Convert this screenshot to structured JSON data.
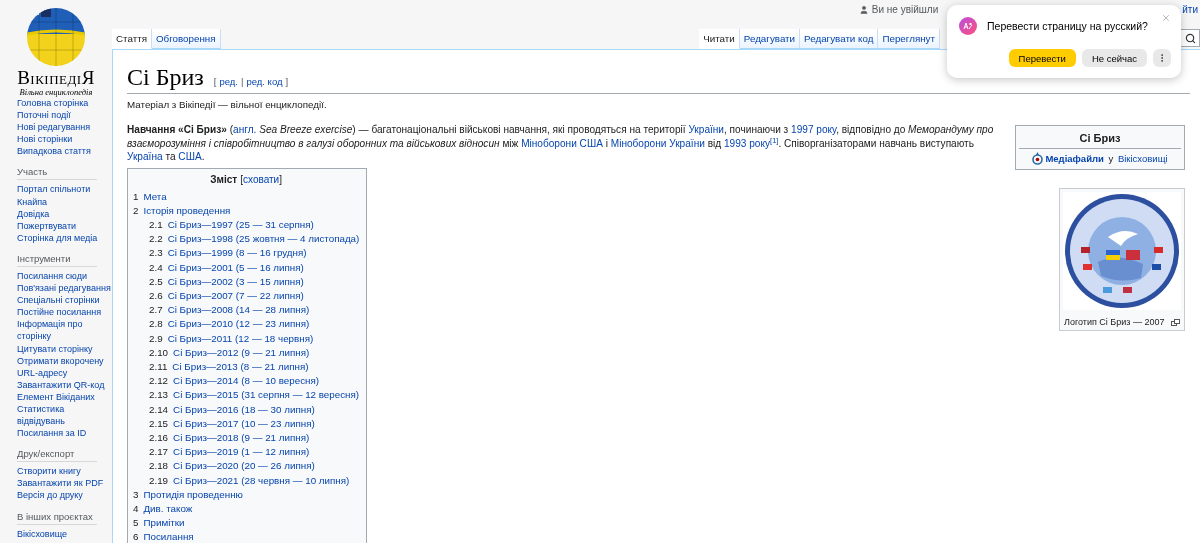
{
  "logo": {
    "wordmark": "ВікіпедіЯ",
    "tagline": "Вільна енциклопедія"
  },
  "sidebar": {
    "sections": [
      {
        "items": [
          "Головна сторінка",
          "Поточні події",
          "Нові редагування",
          "Нові сторінки",
          "Випадкова стаття"
        ]
      },
      {
        "heading": "Участь",
        "items": [
          "Портал спільноти",
          "Кнайпа",
          "Довідка",
          "Пожертвувати",
          "Сторінка для медіа"
        ]
      },
      {
        "heading": "Інструменти",
        "items": [
          "Посилання сюди",
          "Пов'язані редагування",
          "Спеціальні сторінки",
          "Постійне посилання",
          "Інформація про сторінку",
          "Цитувати сторінку",
          "Отримати вкорочену URL-адресу",
          "Завантажити QR-код",
          "Елемент Вікіданих",
          "Статистика відвідувань",
          "Посилання за ID"
        ]
      },
      {
        "heading": "Друк/експорт",
        "items": [
          "Створити книгу",
          "Завантажити як PDF",
          "Версія до друку"
        ]
      },
      {
        "heading": "В інших проєктах",
        "items": [
          "Вікісховище"
        ]
      }
    ]
  },
  "personal": {
    "status": "Ви не увійшли",
    "login": "йти"
  },
  "namespace_tabs": [
    {
      "label": "Стаття",
      "selected": true
    },
    {
      "label": "Обговорення",
      "selected": false
    }
  ],
  "view_tabs": [
    {
      "label": "Читати",
      "selected": true
    },
    {
      "label": "Редагувати",
      "selected": false
    },
    {
      "label": "Редагувати код",
      "selected": false
    },
    {
      "label": "Переглянут",
      "selected": false
    }
  ],
  "title": "Сі Бриз",
  "edit_links": {
    "open": "[",
    "links": [
      "ред.",
      "ред. код"
    ],
    "separator": "|",
    "close": "]"
  },
  "site_sub": "Матеріал з Вікіпедії — вільної енциклопедії.",
  "intro": [
    {
      "text": "**Навчання «Сі Бриз»** (",
      "link": false
    },
    {
      "text": "англ.",
      "link": true
    },
    {
      "text": " *Sea Breeze exercise*) — багатонаціональні військові навчання, які проводяться на території ",
      "link": false
    },
    {
      "text": "України",
      "link": true
    },
    {
      "text": ", починаючи з ",
      "link": false
    },
    {
      "text": "1997 року",
      "link": true
    },
    {
      "text": ", відповідно до *Меморандуму про взаєморозуміння і співробітництво в галузі оборонних та військових відносин* між ",
      "link": false
    },
    {
      "text": "Міноборони США",
      "link": true
    },
    {
      "text": " і ",
      "link": false
    },
    {
      "text": "Міноборони України",
      "link": true
    },
    {
      "text": " від ",
      "link": false
    },
    {
      "text": "1993 року",
      "link": true
    },
    {
      "text": "$^{[1]}$",
      "link": true
    },
    {
      "text": ". Співорганізаторами навчань виступають ",
      "link": false
    },
    {
      "text": "Україна",
      "link": true
    },
    {
      "text": " та ",
      "link": false
    },
    {
      "text": "США",
      "link": true
    },
    {
      "text": ".",
      "link": false
    }
  ],
  "toc": {
    "title": "Зміст",
    "toggle_open": "[",
    "toggle": "сховати",
    "toggle_close": "]",
    "items": [
      {
        "number": "1",
        "text": "Мета"
      },
      {
        "number": "2",
        "text": "Історія проведення",
        "children": [
          {
            "number": "2.1",
            "text": "Сі Бриз—1997 (25 — 31 серпня)"
          },
          {
            "number": "2.2",
            "text": "Сі Бриз—1998 (25 жовтня — 4 листопада)"
          },
          {
            "number": "2.3",
            "text": "Сі Бриз—1999 (8 — 16 грудня)"
          },
          {
            "number": "2.4",
            "text": "Сі Бриз—2001 (5 — 16 липня)"
          },
          {
            "number": "2.5",
            "text": "Сі Бриз—2002 (3 — 15 липня)"
          },
          {
            "number": "2.6",
            "text": "Сі Бриз—2007 (7 — 22 липня)"
          },
          {
            "number": "2.7",
            "text": "Сі Бриз—2008 (14 — 28 липня)"
          },
          {
            "number": "2.8",
            "text": "Сі Бриз—2010 (12 — 23 липня)"
          },
          {
            "number": "2.9",
            "text": "Сі Бриз—2011 (12 — 18 червня)"
          },
          {
            "number": "2.10",
            "text": "Сі Бриз—2012 (9 — 21 липня)"
          },
          {
            "number": "2.11",
            "text": "Сі Бриз—2013 (8 — 21 липня)"
          },
          {
            "number": "2.12",
            "text": "Сі Бриз—2014 (8 — 10 вересня)"
          },
          {
            "number": "2.13",
            "text": "Сі Бриз—2015 (31 серпня — 12 вересня)"
          },
          {
            "number": "2.14",
            "text": "Сі Бриз—2016 (18 — 30 липня)"
          },
          {
            "number": "2.15",
            "text": "Сі Бриз—2017 (10 — 23 липня)"
          },
          {
            "number": "2.16",
            "text": "Сі Бриз—2018 (9 — 21 липня)"
          },
          {
            "number": "2.17",
            "text": "Сі Бриз—2019 (1 — 12 липня)"
          },
          {
            "number": "2.18",
            "text": "Сі Бриз—2020 (20 — 26 липня)"
          },
          {
            "number": "2.19",
            "text": "Сі Бриз—2021 (28 червня — 10 липня)"
          }
        ]
      },
      {
        "number": "3",
        "text": "Протидія проведенню"
      },
      {
        "number": "4",
        "text": "Див. також"
      },
      {
        "number": "5",
        "text": "Примітки"
      },
      {
        "number": "6",
        "text": "Посилання"
      }
    ]
  },
  "infobox": {
    "title": "Сі Бриз",
    "media": [
      {
        "text": "Медіафайли",
        "link": true,
        "bold": true
      },
      {
        "text": " у ",
        "link": false,
        "bold": false
      },
      {
        "text": "Вікісховищі",
        "link": true,
        "bold": false
      }
    ]
  },
  "thumb": {
    "kind": "picture",
    "caption": "Логотип Сі Бриз — 2007"
  },
  "translate_popup": {
    "question": "Перевести страницу на русский?",
    "buttons": [
      {
        "label": "Перевести",
        "kind": "primary"
      },
      {
        "label": "Не сейчас",
        "kind": "secondary"
      }
    ]
  }
}
